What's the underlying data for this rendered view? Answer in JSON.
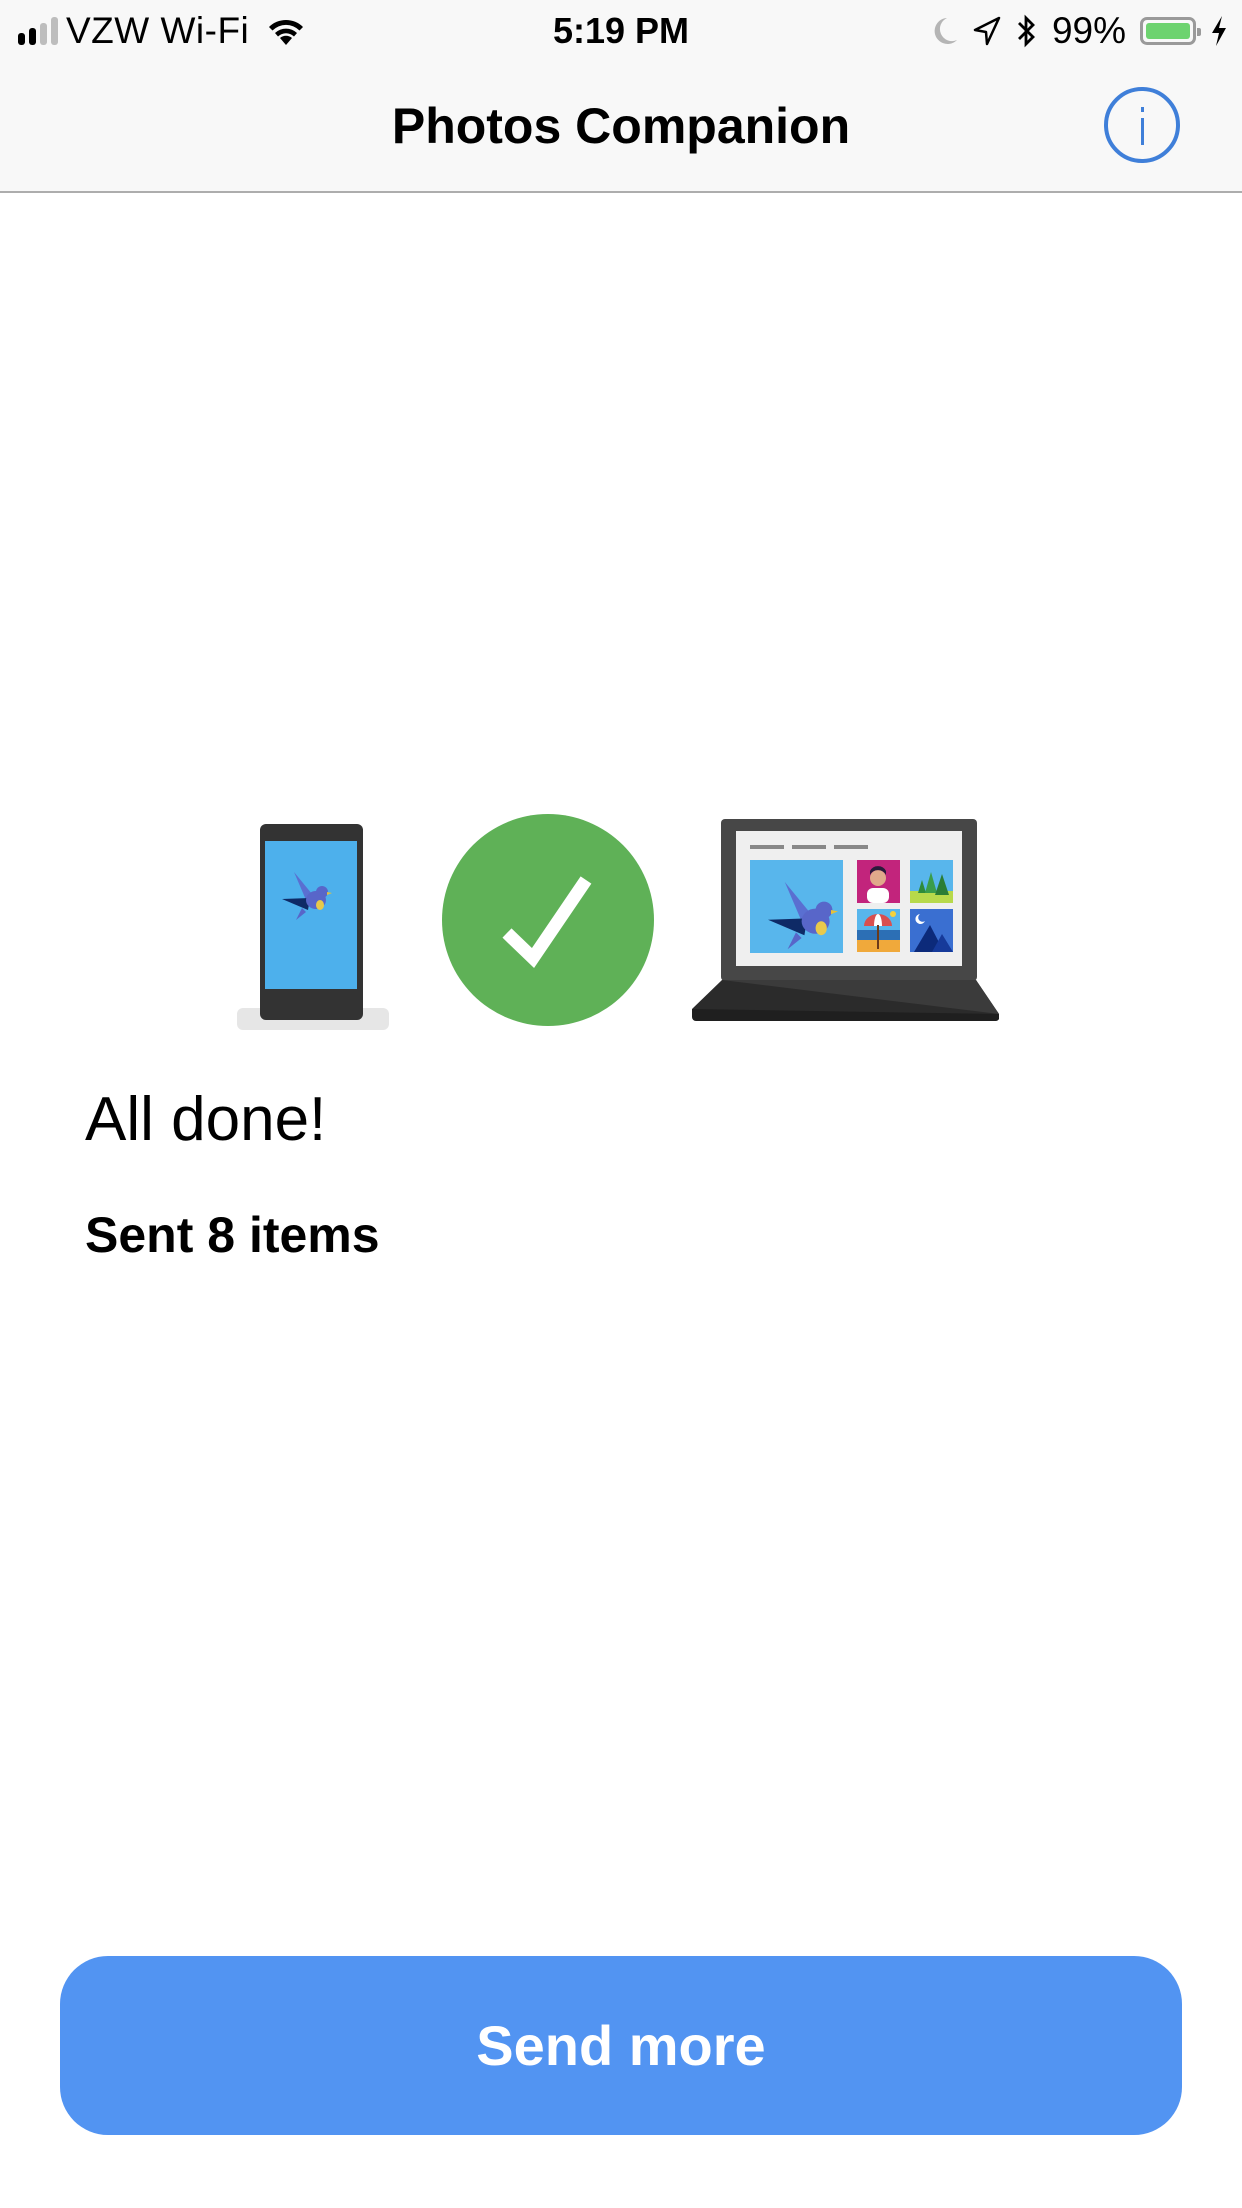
{
  "status_bar": {
    "carrier": "VZW Wi-Fi",
    "signal_bars_filled": 2,
    "signal_bars_total": 4,
    "time": "5:19 PM",
    "icons": [
      "wifi-icon",
      "moon-icon",
      "location-arrow-icon",
      "bluetooth-icon",
      "battery-icon",
      "charging-bolt-icon"
    ],
    "battery_percent_label": "99%",
    "battery_level": 0.99,
    "battery_color": "#6dd36f"
  },
  "nav": {
    "title": "Photos Companion",
    "info_icon": "info-icon",
    "accent_color": "#3f7fd9"
  },
  "illustration": {
    "phone": "phone-icon",
    "status": "checkmark-circle-icon",
    "status_color": "#5fb157",
    "laptop": "laptop-icon"
  },
  "main": {
    "heading": "All done!",
    "subheading": "Sent 8 items"
  },
  "actions": {
    "send_more_label": "Send more",
    "button_color": "#5294f2"
  }
}
